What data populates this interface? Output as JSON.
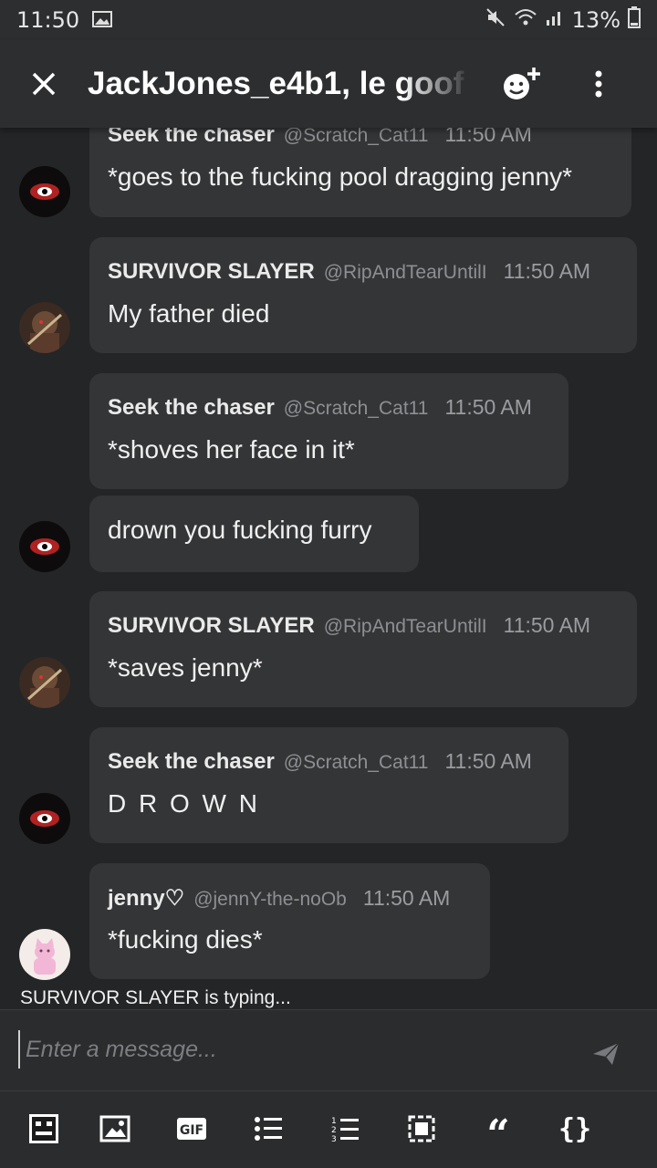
{
  "status_bar": {
    "time": "11:50",
    "battery": "13%"
  },
  "header": {
    "title": "JackJones_e4b1, le goof"
  },
  "messages": [
    {
      "name": "Seek the chaser",
      "handle": "@Scratch_Cat11",
      "time": "11:50 AM",
      "text": "*goes to the fucking pool dragging jenny*"
    },
    {
      "name": "SURVIVOR SLAYER",
      "handle": "@RipAndTearUntilI",
      "time": "11:50 AM",
      "text": "My father died"
    },
    {
      "name": "Seek the chaser",
      "handle": "@Scratch_Cat11",
      "time": "11:50 AM",
      "text": "*shoves her face in it*"
    },
    {
      "text": "drown you fucking furry"
    },
    {
      "name": "SURVIVOR SLAYER",
      "handle": "@RipAndTearUntilI",
      "time": "11:50 AM",
      "text": "*saves jenny*"
    },
    {
      "name": "Seek the chaser",
      "handle": "@Scratch_Cat11",
      "time": "11:50 AM",
      "text": "D R O W N"
    },
    {
      "name": "jenny♡",
      "handle": "@jennY-the-noOb",
      "time": "11:50 AM",
      "text": "*fucking dies*"
    }
  ],
  "typing_indicator": "SURVIVOR SLAYER is typing...",
  "composer": {
    "placeholder": "Enter a message..."
  },
  "toolbar": {
    "gif_label": "GIF",
    "quote_glyph": "“",
    "code_glyph": "{}"
  }
}
